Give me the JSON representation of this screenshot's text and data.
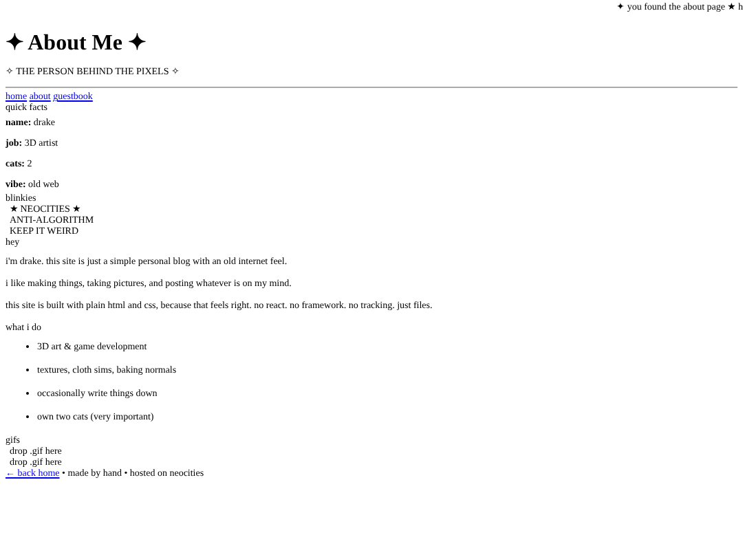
{
  "marquee": "✦ you found the about page ★ h",
  "title": "✦ About Me ✦",
  "subtitle": "✧ THE PERSON BEHIND THE PIXELS ✧",
  "nav": [
    "home",
    "about",
    "guestbook"
  ],
  "facts": {
    "heading": "quick facts",
    "items": [
      {
        "label": "name:",
        "value": "drake"
      },
      {
        "label": "job:",
        "value": "3D artist"
      },
      {
        "label": "cats:",
        "value": "2"
      },
      {
        "label": "vibe:",
        "value": "old web"
      }
    ]
  },
  "blinkies": {
    "heading": "blinkies",
    "items": [
      "★ NEOCITIES ★",
      "ANTI-ALGORITHM",
      "KEEP IT WEIRD"
    ]
  },
  "hey": {
    "heading": "hey",
    "paragraphs": [
      "i'm drake. this site is just a simple personal blog with an old internet feel.",
      "i like making things, taking pictures, and posting whatever is on my mind.",
      "this site is built with plain html and css, because that feels right. no react. no framework. no tracking. just files."
    ]
  },
  "what_i_do": {
    "heading": "what i do",
    "items": [
      "3D art & game development",
      "textures, cloth sims, baking normals",
      "occasionally write things down",
      "own two cats (very important)"
    ]
  },
  "gifs": {
    "heading": "gifs",
    "items": [
      "drop .gif here",
      "drop .gif here"
    ]
  },
  "footer": {
    "link": "← back home",
    "text": "• made by hand • hosted on neocities"
  }
}
